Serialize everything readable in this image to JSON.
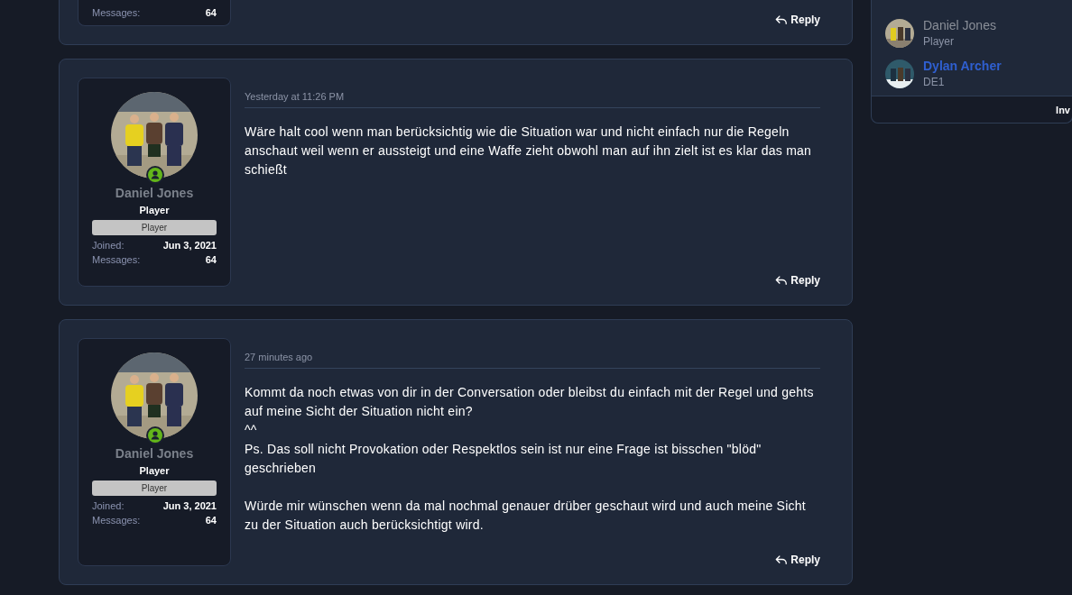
{
  "posts": [
    {
      "author": {
        "stats": [
          {
            "label": "Messages:",
            "value": "64"
          }
        ]
      },
      "reply": "Reply"
    },
    {
      "author": {
        "name": "Daniel Jones",
        "title": "Player",
        "banner": "Player",
        "online": true,
        "stats": [
          {
            "label": "Joined:",
            "value": "Jun 3, 2021"
          },
          {
            "label": "Messages:",
            "value": "64"
          }
        ]
      },
      "time": "Yesterday at 11:26 PM",
      "paragraphs": [
        "Wäre halt cool wenn man berücksichtig wie die Situation war und nicht einfach nur die Regeln anschaut weil wenn er aussteigt und eine Waffe zieht obwohl man auf ihn zielt ist es klar das man schießt"
      ],
      "reply": "Reply"
    },
    {
      "author": {
        "name": "Daniel Jones",
        "title": "Player",
        "banner": "Player",
        "online": true,
        "stats": [
          {
            "label": "Joined:",
            "value": "Jun 3, 2021"
          },
          {
            "label": "Messages:",
            "value": "64"
          }
        ]
      },
      "time": "27 minutes ago",
      "paragraphs": [
        "Kommt da noch etwas von dir in der Conversation oder bleibst du einfach mit der Regel und gehts auf meine Sicht der Situation nicht ein?\n^^\nPs. Das soll nicht Provokation oder Respektlos sein ist nur eine Frage ist bisschen \"blöd\" geschrieben",
        "Würde mir wünschen wenn da mal nochmal genauer drüber geschaut wird und auch meine Sicht zu der Situation auch berücksichtigt wird."
      ],
      "reply": "Reply"
    }
  ],
  "sidebar": {
    "members": [
      {
        "name": "Daniel Jones",
        "role": "Player",
        "color": "#8a8f98"
      },
      {
        "name": "Dylan Archer",
        "role": "DE1",
        "color": "#2f5fd0"
      }
    ],
    "footer_button": "Inv"
  }
}
